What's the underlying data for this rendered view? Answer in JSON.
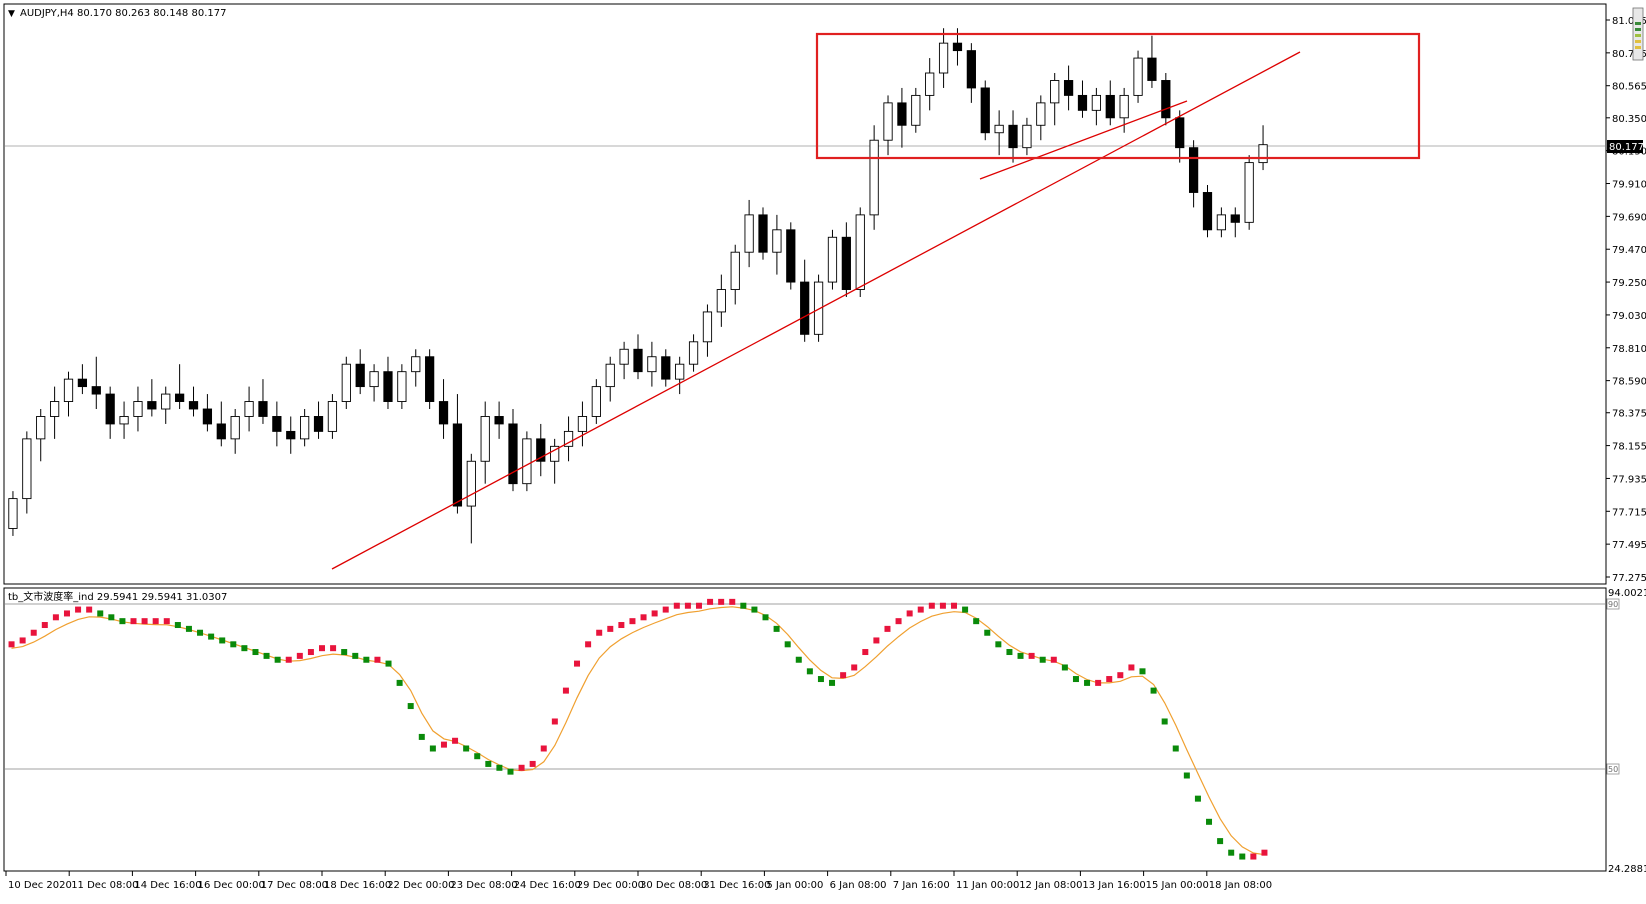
{
  "symbol_header": {
    "menu_icon": "triangle-down-icon",
    "text": "AUDJPY,H4  80.170 80.263 80.148 80.177"
  },
  "price_axis": {
    "labels": [
      "81.005",
      "80.785",
      "80.565",
      "80.350",
      "80.130",
      "79.910",
      "79.690",
      "79.470",
      "79.250",
      "79.030",
      "78.810",
      "78.590",
      "78.375",
      "78.155",
      "77.935",
      "77.715",
      "77.495",
      "77.275"
    ],
    "current_price": "80.177"
  },
  "indicator": {
    "name_text": "tb_文市波度率_ind 29.5941 29.5941 31.0307",
    "axis_top": "94.0021",
    "axis_bottom": "24.2881",
    "level_90": "90",
    "level_50": "50"
  },
  "time_axis": {
    "labels": [
      "10 Dec 2020",
      "11 Dec 08:00",
      "14 Dec 16:00",
      "16 Dec 00:00",
      "17 Dec 08:00",
      "18 Dec 16:00",
      "22 Dec 00:00",
      "23 Dec 08:00",
      "24 Dec 16:00",
      "29 Dec 00:00",
      "30 Dec 08:00",
      "31 Dec 16:00",
      "5 Jan 00:00",
      "6 Jan 08:00",
      "7 Jan 16:00",
      "11 Jan 00:00",
      "12 Jan 08:00",
      "13 Jan 16:00",
      "15 Jan 00:00",
      "18 Jan 08:00"
    ]
  },
  "colors": {
    "bull_candle": "#ffffff",
    "bear_candle": "#000000",
    "trendline": "#dd0000",
    "box": "#e02020",
    "indicator_up": "#e8143c",
    "indicator_down": "#0a8a0a",
    "signal_line": "#f0a030"
  },
  "chart_data": [
    {
      "type": "candlestick",
      "title": "AUDJPY,H4",
      "ohlc_last": {
        "open": 80.17,
        "high": 80.263,
        "low": 80.148,
        "close": 80.177
      },
      "ylim": [
        77.275,
        81.005
      ],
      "y_ticks": [
        81.005,
        80.785,
        80.565,
        80.35,
        80.13,
        79.91,
        79.69,
        79.47,
        79.25,
        79.03,
        78.81,
        78.59,
        78.375,
        78.155,
        77.935,
        77.715,
        77.495,
        77.275
      ],
      "x_ticks": [
        "10 Dec 2020",
        "11 Dec 08:00",
        "14 Dec 16:00",
        "16 Dec 00:00",
        "17 Dec 08:00",
        "18 Dec 16:00",
        "22 Dec 00:00",
        "23 Dec 08:00",
        "24 Dec 16:00",
        "29 Dec 00:00",
        "30 Dec 08:00",
        "31 Dec 16:00",
        "5 Jan 00:00",
        "6 Jan 08:00",
        "7 Jan 16:00",
        "11 Jan 00:00",
        "12 Jan 08:00",
        "13 Jan 16:00",
        "15 Jan 00:00",
        "18 Jan 08:00"
      ],
      "candles": [
        [
          77.6,
          77.85,
          77.55,
          77.8
        ],
        [
          77.8,
          78.25,
          77.7,
          78.2
        ],
        [
          78.2,
          78.4,
          78.05,
          78.35
        ],
        [
          78.35,
          78.55,
          78.2,
          78.45
        ],
        [
          78.45,
          78.65,
          78.35,
          78.6
        ],
        [
          78.6,
          78.7,
          78.5,
          78.55
        ],
        [
          78.55,
          78.75,
          78.4,
          78.5
        ],
        [
          78.5,
          78.55,
          78.2,
          78.3
        ],
        [
          78.3,
          78.45,
          78.2,
          78.35
        ],
        [
          78.35,
          78.55,
          78.25,
          78.45
        ],
        [
          78.45,
          78.6,
          78.35,
          78.4
        ],
        [
          78.4,
          78.55,
          78.3,
          78.5
        ],
        [
          78.5,
          78.7,
          78.4,
          78.45
        ],
        [
          78.45,
          78.55,
          78.35,
          78.4
        ],
        [
          78.4,
          78.5,
          78.25,
          78.3
        ],
        [
          78.3,
          78.45,
          78.15,
          78.2
        ],
        [
          78.2,
          78.4,
          78.1,
          78.35
        ],
        [
          78.35,
          78.55,
          78.25,
          78.45
        ],
        [
          78.45,
          78.6,
          78.3,
          78.35
        ],
        [
          78.35,
          78.45,
          78.15,
          78.25
        ],
        [
          78.25,
          78.35,
          78.1,
          78.2
        ],
        [
          78.2,
          78.4,
          78.15,
          78.35
        ],
        [
          78.35,
          78.45,
          78.2,
          78.25
        ],
        [
          78.25,
          78.5,
          78.2,
          78.45
        ],
        [
          78.45,
          78.75,
          78.4,
          78.7
        ],
        [
          78.7,
          78.8,
          78.5,
          78.55
        ],
        [
          78.55,
          78.7,
          78.45,
          78.65
        ],
        [
          78.65,
          78.75,
          78.4,
          78.45
        ],
        [
          78.45,
          78.7,
          78.4,
          78.65
        ],
        [
          78.65,
          78.8,
          78.55,
          78.75
        ],
        [
          78.75,
          78.8,
          78.4,
          78.45
        ],
        [
          78.45,
          78.6,
          78.2,
          78.3
        ],
        [
          78.3,
          78.5,
          77.7,
          77.75
        ],
        [
          77.75,
          78.1,
          77.5,
          78.05
        ],
        [
          78.05,
          78.45,
          77.9,
          78.35
        ],
        [
          78.35,
          78.45,
          78.2,
          78.3
        ],
        [
          78.3,
          78.4,
          77.85,
          77.9
        ],
        [
          77.9,
          78.25,
          77.85,
          78.2
        ],
        [
          78.2,
          78.3,
          77.95,
          78.05
        ],
        [
          78.05,
          78.2,
          77.9,
          78.15
        ],
        [
          78.15,
          78.35,
          78.05,
          78.25
        ],
        [
          78.25,
          78.45,
          78.15,
          78.35
        ],
        [
          78.35,
          78.6,
          78.3,
          78.55
        ],
        [
          78.55,
          78.75,
          78.45,
          78.7
        ],
        [
          78.7,
          78.85,
          78.6,
          78.8
        ],
        [
          78.8,
          78.9,
          78.6,
          78.65
        ],
        [
          78.65,
          78.85,
          78.55,
          78.75
        ],
        [
          78.75,
          78.8,
          78.55,
          78.6
        ],
        [
          78.6,
          78.75,
          78.5,
          78.7
        ],
        [
          78.7,
          78.9,
          78.65,
          78.85
        ],
        [
          78.85,
          79.1,
          78.75,
          79.05
        ],
        [
          79.05,
          79.3,
          78.95,
          79.2
        ],
        [
          79.2,
          79.5,
          79.1,
          79.45
        ],
        [
          79.45,
          79.8,
          79.35,
          79.7
        ],
        [
          79.7,
          79.75,
          79.4,
          79.45
        ],
        [
          79.45,
          79.7,
          79.3,
          79.6
        ],
        [
          79.6,
          79.65,
          79.2,
          79.25
        ],
        [
          79.25,
          79.4,
          78.85,
          78.9
        ],
        [
          78.9,
          79.3,
          78.85,
          79.25
        ],
        [
          79.25,
          79.6,
          79.2,
          79.55
        ],
        [
          79.55,
          79.65,
          79.15,
          79.2
        ],
        [
          79.2,
          79.75,
          79.15,
          79.7
        ],
        [
          79.7,
          80.3,
          79.6,
          80.2
        ],
        [
          80.2,
          80.5,
          80.1,
          80.45
        ],
        [
          80.45,
          80.55,
          80.15,
          80.3
        ],
        [
          80.3,
          80.55,
          80.25,
          80.5
        ],
        [
          80.5,
          80.75,
          80.4,
          80.65
        ],
        [
          80.65,
          80.95,
          80.55,
          80.85
        ],
        [
          80.85,
          80.95,
          80.7,
          80.8
        ],
        [
          80.8,
          80.85,
          80.45,
          80.55
        ],
        [
          80.55,
          80.6,
          80.2,
          80.25
        ],
        [
          80.25,
          80.4,
          80.1,
          80.3
        ],
        [
          80.3,
          80.4,
          80.05,
          80.15
        ],
        [
          80.15,
          80.35,
          80.1,
          80.3
        ],
        [
          80.3,
          80.5,
          80.2,
          80.45
        ],
        [
          80.45,
          80.65,
          80.3,
          80.6
        ],
        [
          80.6,
          80.7,
          80.4,
          80.5
        ],
        [
          80.5,
          80.6,
          80.35,
          80.4
        ],
        [
          80.4,
          80.55,
          80.3,
          80.5
        ],
        [
          80.5,
          80.6,
          80.3,
          80.35
        ],
        [
          80.35,
          80.55,
          80.25,
          80.5
        ],
        [
          80.5,
          80.8,
          80.45,
          80.75
        ],
        [
          80.75,
          80.9,
          80.55,
          80.6
        ],
        [
          80.6,
          80.65,
          80.3,
          80.35
        ],
        [
          80.35,
          80.4,
          80.05,
          80.15
        ],
        [
          80.15,
          80.2,
          79.75,
          79.85
        ],
        [
          79.85,
          79.9,
          79.55,
          79.6
        ],
        [
          79.6,
          79.75,
          79.55,
          79.7
        ],
        [
          79.7,
          79.75,
          79.55,
          79.65
        ],
        [
          79.65,
          80.1,
          79.6,
          80.05
        ],
        [
          80.05,
          80.3,
          80.0,
          80.17
        ]
      ],
      "trendlines": [
        {
          "from": "18 Dec 16:00",
          "to": "15 Jan 00:00",
          "direction": "rising"
        },
        {
          "from": "11 Jan 00:00",
          "to": "15 Jan 00:00",
          "direction": "rising"
        }
      ],
      "highlight_box": {
        "price_top": 80.95,
        "price_bottom": 80.12,
        "from": "6 Jan 08:00",
        "to": "18 Jan 08:00"
      }
    },
    {
      "type": "scatter",
      "title": "tb_文市波度率_ind",
      "ylim": [
        24.2881,
        94.0021
      ],
      "levels": [
        90,
        50
      ],
      "values": [
        82,
        83,
        85,
        87,
        89,
        90,
        91,
        91,
        90,
        89,
        88,
        88,
        88,
        88,
        88,
        87,
        86,
        85,
        84,
        83,
        82,
        81,
        80,
        79,
        78,
        78,
        79,
        80,
        81,
        81,
        80,
        79,
        78,
        78,
        77,
        72,
        66,
        58,
        55,
        56,
        57,
        55,
        53,
        51,
        50,
        49,
        50,
        51,
        55,
        62,
        70,
        77,
        82,
        85,
        86,
        87,
        88,
        89,
        90,
        91,
        92,
        92,
        92,
        93,
        93,
        93,
        92,
        91,
        89,
        86,
        82,
        78,
        75,
        73,
        72,
        74,
        76,
        80,
        83,
        86,
        88,
        90,
        91,
        92,
        92,
        92,
        91,
        88,
        85,
        82,
        80,
        79,
        79,
        78,
        78,
        76,
        73,
        72,
        72,
        73,
        74,
        76,
        75,
        70,
        62,
        55,
        48,
        42,
        36,
        31,
        28,
        27,
        27,
        28
      ],
      "colors_rule": "red = rising, green = falling",
      "signal_line": "smoothed moving average of the values"
    }
  ]
}
